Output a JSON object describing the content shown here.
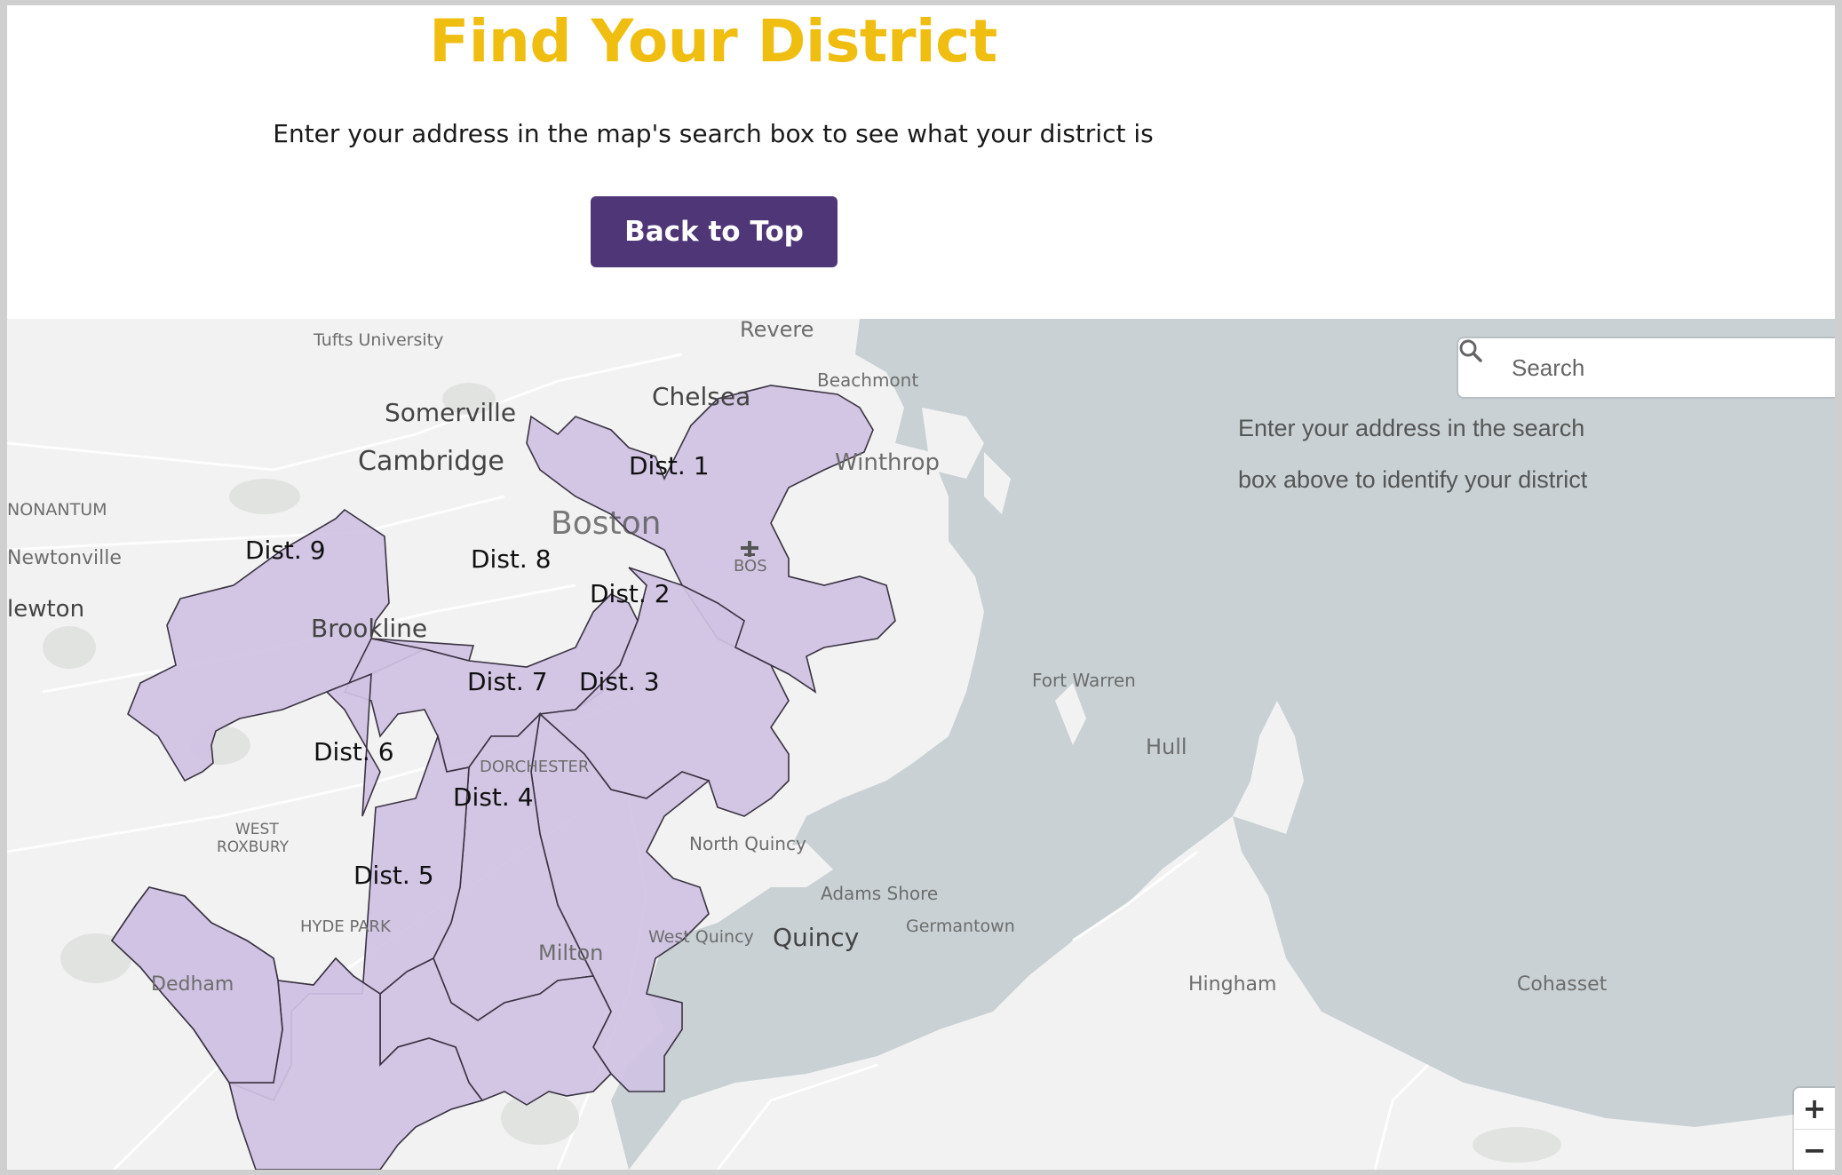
{
  "header": {
    "title": "Find Your District",
    "subtitle": "Enter your address in the map's search box to see what your district is",
    "back_button_label": "Back to Top"
  },
  "map": {
    "search": {
      "placeholder": "Search",
      "icon": "search-icon"
    },
    "instructions_line1": "Enter your address in the search",
    "instructions_line2": "box above to identify your district",
    "zoom_in_label": "+",
    "zoom_out_label": "−",
    "place_labels": {
      "tufts": "Tufts University",
      "revere": "Revere",
      "beachmont": "Beachmont",
      "chelsea": "Chelsea",
      "somerville": "Somerville",
      "cambridge": "Cambridge",
      "winthrop": "Winthrop",
      "nonantum": "NONANTUM",
      "boston": "Boston",
      "bos": "BOS",
      "newtonville": "Newtonville",
      "newton": "lewton",
      "brookline": "Brookline",
      "fort_warren": "Fort Warren",
      "hull": "Hull",
      "dorchester": "DORCHESTER",
      "west_roxbury_1": "WEST",
      "west_roxbury_2": "ROXBURY",
      "north_quincy": "North Quincy",
      "adams_shore": "Adams Shore",
      "germantown": "Germantown",
      "west_quincy": "West Quincy",
      "quincy": "Quincy",
      "milton": "Milton",
      "hyde_park": "HYDE PARK",
      "dedham": "Dedham",
      "hingham": "Hingham",
      "cohasset": "Cohasset"
    },
    "districts": {
      "d1": "Dist. 1",
      "d2": "Dist. 2",
      "d3": "Dist. 3",
      "d4": "Dist. 4",
      "d5": "Dist. 5",
      "d6": "Dist. 6",
      "d7": "Dist. 7",
      "d8": "Dist. 8",
      "d9": "Dist. 9"
    },
    "colors": {
      "water": "#c9d1d4",
      "land": "#f2f2f2",
      "district_fill": "#cfc2e3",
      "district_stroke": "#3a3242"
    }
  }
}
